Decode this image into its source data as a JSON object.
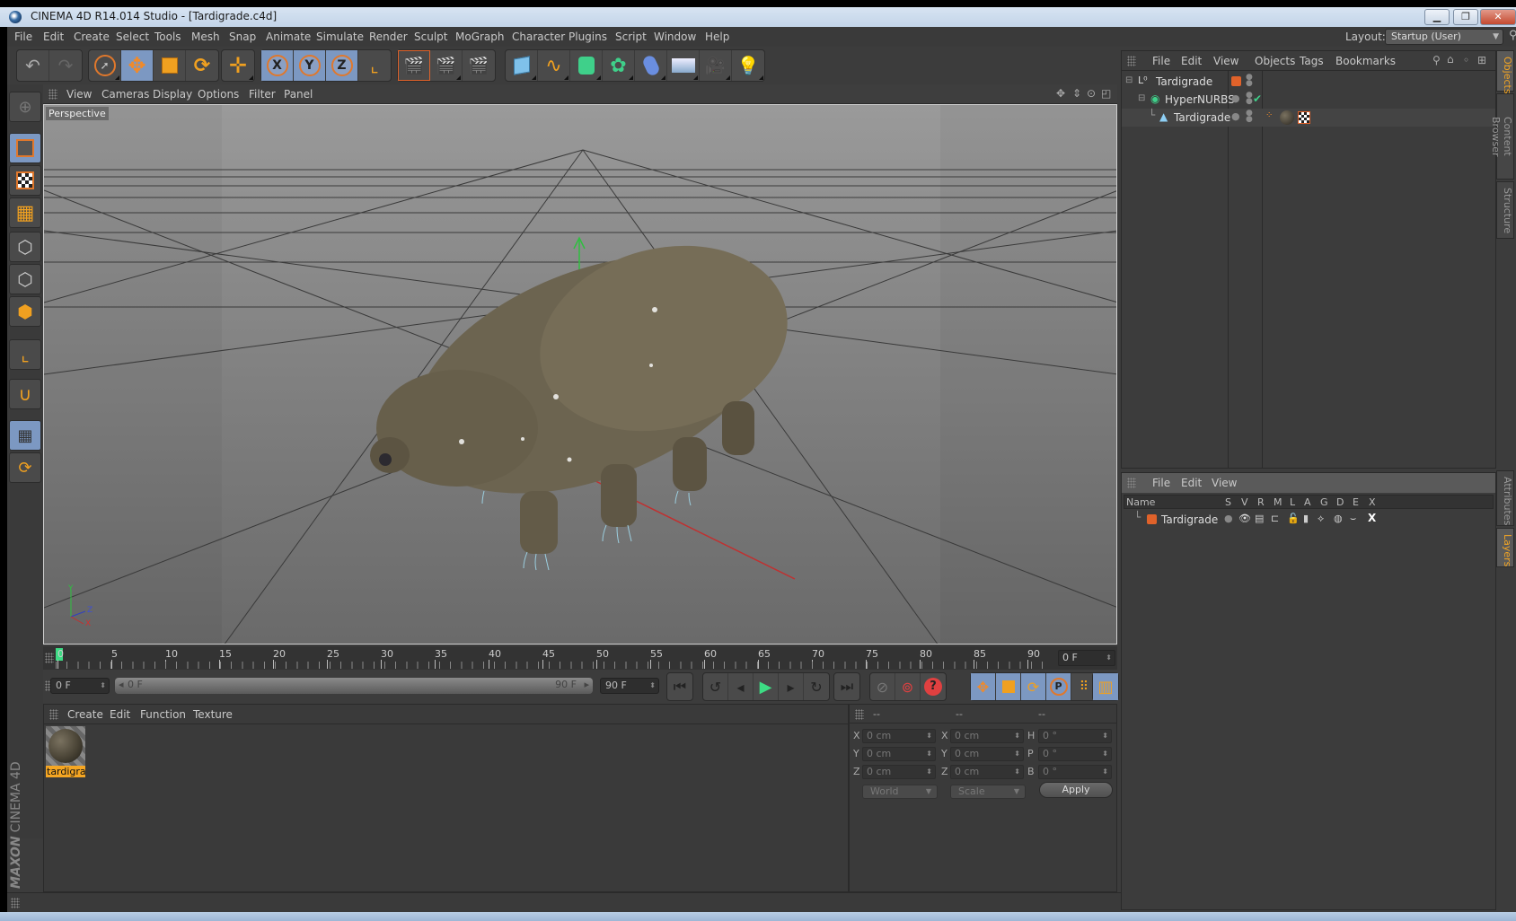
{
  "window": {
    "title": "CINEMA 4D R14.014 Studio - [Tardigrade.c4d]",
    "controls": [
      "minimize",
      "restore",
      "close"
    ]
  },
  "menubar": {
    "items": [
      "File",
      "Edit",
      "Create",
      "Select",
      "Tools",
      "Mesh",
      "Snap",
      "Animate",
      "Simulate",
      "Render",
      "Sculpt",
      "MoGraph",
      "Character",
      "Plugins",
      "Script",
      "Window",
      "Help"
    ],
    "layout_label": "Layout:",
    "layout_value": "Startup (User)"
  },
  "toolbar": {
    "axis_labels": [
      "X",
      "Y",
      "Z"
    ]
  },
  "viewport": {
    "menu": [
      "View",
      "Cameras",
      "Display",
      "Options",
      "Filter",
      "Panel"
    ],
    "camera_label": "Perspective",
    "axis_labels": {
      "y": "Y",
      "z": "Z",
      "x": "X"
    }
  },
  "timeline": {
    "ticks": [
      "0",
      "5",
      "10",
      "15",
      "20",
      "25",
      "30",
      "35",
      "40",
      "45",
      "50",
      "55",
      "60",
      "65",
      "70",
      "75",
      "80",
      "85",
      "90"
    ],
    "current_frame": "0 F",
    "start_field": "0 F",
    "range_start": "0 F",
    "range_end": "90 F",
    "end_field": "90 F"
  },
  "material_manager": {
    "menu": [
      "Create",
      "Edit",
      "Function",
      "Texture"
    ],
    "materials": [
      {
        "name": "tardigra"
      }
    ]
  },
  "coordinates": {
    "headers": [
      "--",
      "--",
      "--"
    ],
    "rows": [
      {
        "label1": "X",
        "val1": "0 cm",
        "label2": "X",
        "val2": "0 cm",
        "label3": "H",
        "val3": "0 °"
      },
      {
        "label1": "Y",
        "val1": "0 cm",
        "label2": "Y",
        "val2": "0 cm",
        "label3": "P",
        "val3": "0 °"
      },
      {
        "label1": "Z",
        "val1": "0 cm",
        "label2": "Z",
        "val2": "0 cm",
        "label3": "B",
        "val3": "0 °"
      }
    ],
    "mode": "World",
    "type": "Scale",
    "apply": "Apply"
  },
  "object_manager": {
    "menu": [
      "File",
      "Edit",
      "View",
      "Objects",
      "Tags",
      "Bookmarks"
    ],
    "objects": [
      {
        "name": "Tardigrade",
        "type": "null"
      },
      {
        "name": "HyperNURBS",
        "type": "hypernurbs"
      },
      {
        "name": "Tardigrade",
        "type": "polygon"
      }
    ]
  },
  "layer_manager": {
    "menu": [
      "File",
      "Edit",
      "View"
    ],
    "columns": [
      "Name",
      "S",
      "V",
      "R",
      "M",
      "L",
      "A",
      "G",
      "D",
      "E",
      "X"
    ],
    "layers": [
      {
        "name": "Tardigrade",
        "color": "#e0622a"
      }
    ]
  },
  "side_tabs": {
    "top": [
      "Objects",
      "Content Browser",
      "Structure"
    ],
    "bottom": [
      "Attributes",
      "Layers"
    ]
  },
  "brand": {
    "maxon": "MAXON",
    "product": "CINEMA 4D"
  },
  "colors": {
    "accent": "#f5a623",
    "active_tool": "#7c98c2",
    "play": "#3ddc84"
  }
}
